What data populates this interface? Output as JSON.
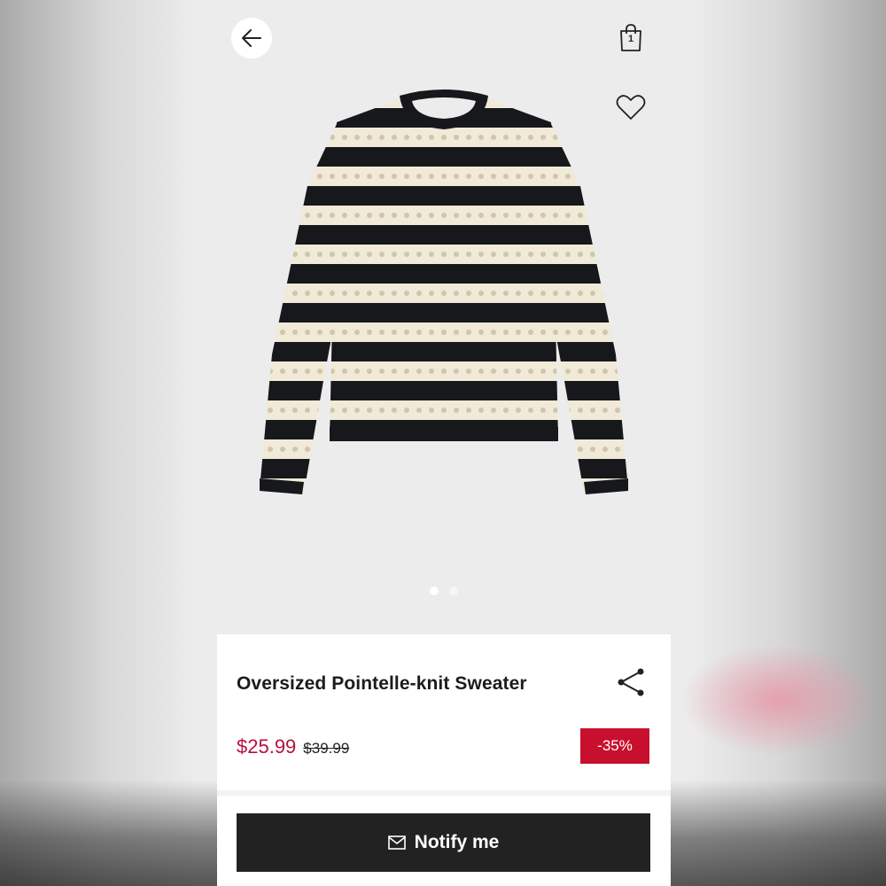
{
  "header": {
    "back_icon": "arrow-left-icon",
    "bag_icon": "shopping-bag-icon",
    "bag_count": "1",
    "favorite_icon": "heart-icon"
  },
  "gallery": {
    "image_subject": "black and cream striped pointelle-knit sweater",
    "page_count": 2,
    "active_page": 1
  },
  "product": {
    "title": "Oversized Pointelle-knit Sweater",
    "share_icon": "share-icon",
    "price_sale": "$25.99",
    "price_original": "$39.99",
    "discount": "-35%"
  },
  "actions": {
    "notify_icon": "envelope-icon",
    "notify_label": "Notify me"
  },
  "colors": {
    "sale_price": "#b5123d",
    "discount_badge": "#c8102e",
    "button_bg": "#222222"
  }
}
